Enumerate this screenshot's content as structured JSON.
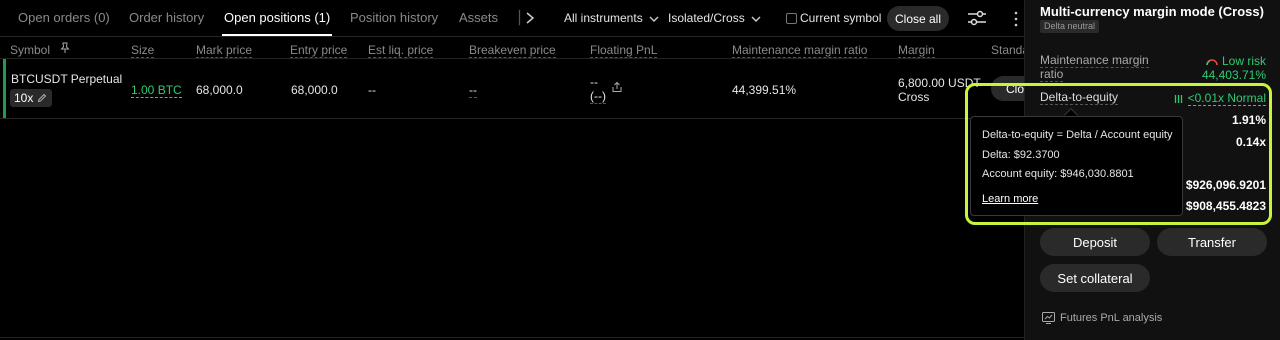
{
  "tabs": [
    {
      "label": "Open orders (0)"
    },
    {
      "label": "Order history"
    },
    {
      "label": "Open positions (1)"
    },
    {
      "label": "Position history"
    },
    {
      "label": "Assets"
    }
  ],
  "filters": {
    "instruments": "All instruments",
    "margin_mode": "Isolated/Cross",
    "current_symbol": "Current symbol",
    "close_all": "Close all"
  },
  "columns": {
    "symbol": "Symbol",
    "size": "Size",
    "mark_price": "Mark price",
    "entry_price": "Entry price",
    "est_liq_price": "Est liq. price",
    "breakeven_price": "Breakeven price",
    "floating_pnl": "Floating PnL",
    "maintenance_margin_ratio": "Maintenance margin ratio",
    "margin": "Margin",
    "standard": "Standa"
  },
  "position": {
    "symbol": "BTCUSDT Perpetual",
    "leverage": "10x",
    "size": "1.00 BTC",
    "mark_price": "68,000.0",
    "entry_price": "68,000.0",
    "est_liq_price": "--",
    "breakeven_price": "--",
    "floating_pnl": "--",
    "floating_pnl_pct": "(--)",
    "maintenance_margin_ratio": "44,399.51%",
    "margin_amount": "6,800.00 USDT",
    "margin_mode": "Cross",
    "close_label": "Clo"
  },
  "account": {
    "title": "Multi-currency margin mode (Cross)",
    "badge": "Delta neutral",
    "mmr_label_line1": "Maintenance margin",
    "mmr_label_line2": "ratio",
    "risk_label": "Low risk",
    "mmr_value": "44,403.71%",
    "dte_label": "Delta-to-equity",
    "dte_value": "<0.01x Normal",
    "val_1": "1.91%",
    "val_2": "0.14x",
    "val_3": "$926,096.9201",
    "val_4": "$908,455.4823",
    "deposit": "Deposit",
    "transfer": "Transfer",
    "set_collateral": "Set collateral",
    "pnl_analysis": "Futures PnL analysis"
  },
  "tooltip": {
    "formula": "Delta-to-equity = Delta / Account equity",
    "delta": "Delta: $92.3700",
    "equity": "Account equity: $946,030.8801",
    "learn_more": "Learn more"
  },
  "colors": {
    "accent_green": "#2ecc71",
    "highlight": "#c8f53a",
    "background": "#000000"
  },
  "icons": [
    "chevron-right-icon",
    "chevron-down-icon",
    "settings-sliders-icon",
    "more-icon",
    "pin-icon",
    "pencil-icon",
    "share-icon",
    "gauge-icon",
    "bars-icon",
    "chart-icon"
  ]
}
